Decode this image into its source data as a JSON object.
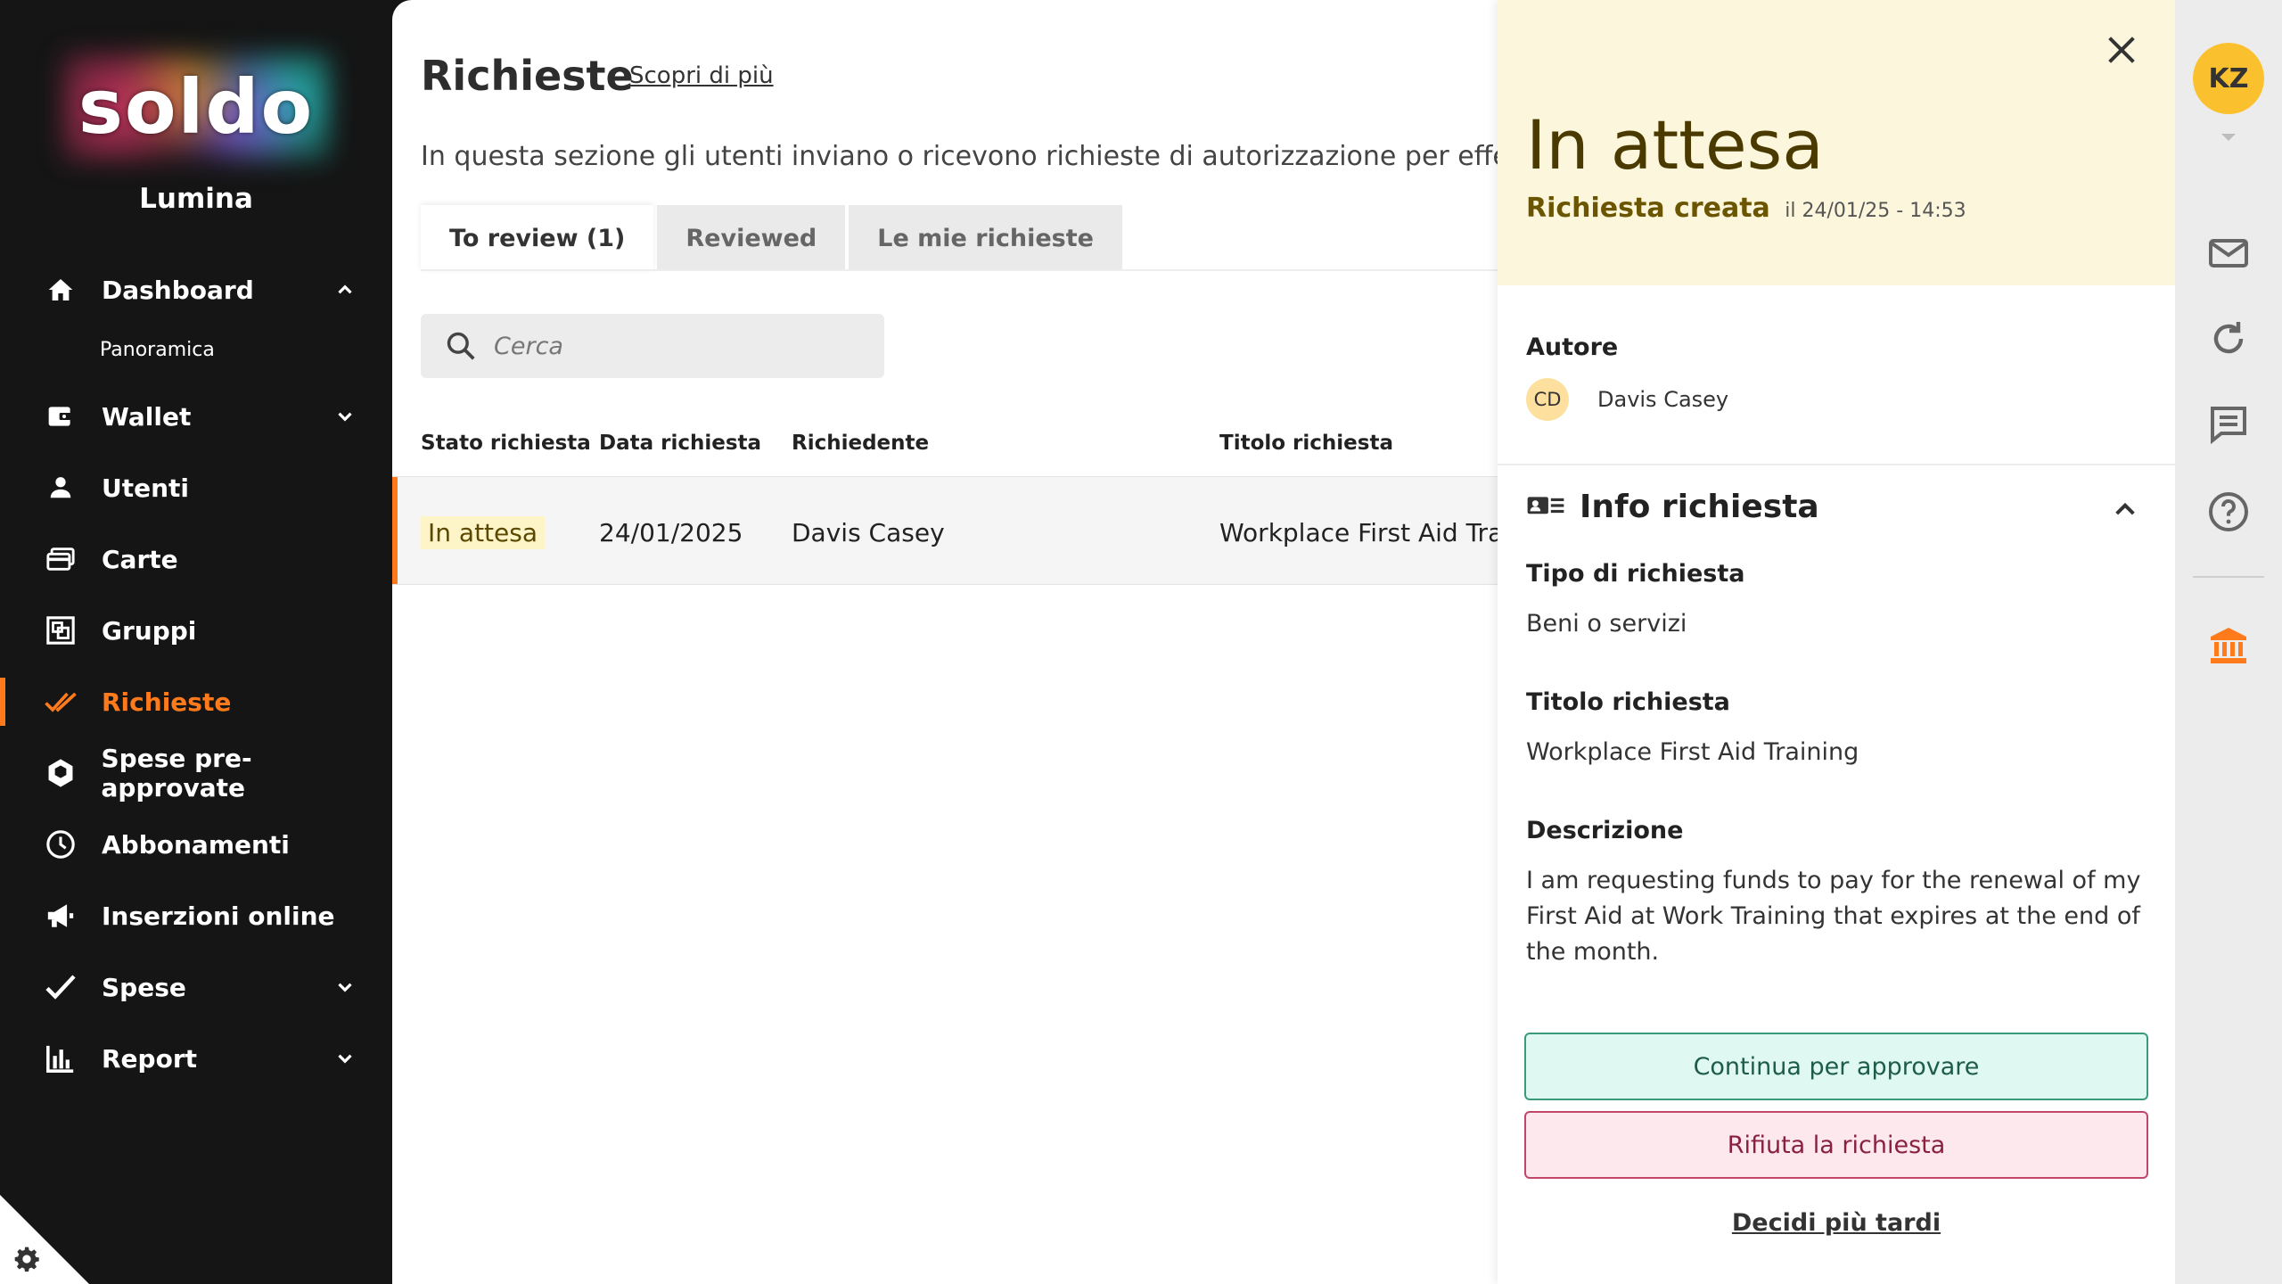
{
  "brand": {
    "logo_text": "soldo",
    "company": "Lumina",
    "accent": "#ff7a1a"
  },
  "sidebar": {
    "items": [
      {
        "label": "Dashboard",
        "icon": "home-icon",
        "chevron": "up"
      },
      {
        "label": "Panoramica",
        "sub": true
      },
      {
        "label": "Wallet",
        "icon": "wallet-icon",
        "chevron": "down"
      },
      {
        "label": "Utenti",
        "icon": "user-icon"
      },
      {
        "label": "Carte",
        "icon": "cards-icon"
      },
      {
        "label": "Gruppi",
        "icon": "groups-icon"
      },
      {
        "label": "Richieste",
        "icon": "double-check-icon",
        "active": true
      },
      {
        "label": "Spese pre-approvate",
        "icon": "hexagon-icon"
      },
      {
        "label": "Abbonamenti",
        "icon": "clock-icon"
      },
      {
        "label": "Inserzioni online",
        "icon": "megaphone-icon"
      },
      {
        "label": "Spese",
        "icon": "check-icon",
        "chevron": "down"
      },
      {
        "label": "Report",
        "icon": "bar-chart-icon",
        "chevron": "down"
      }
    ]
  },
  "main": {
    "title": "Richieste",
    "learn_more": "Scopri di più",
    "intro": "In questa sezione gli utenti inviano o ricevono richieste di autorizzazione per effettuar",
    "tabs": [
      {
        "label": "To review (1)",
        "active": true
      },
      {
        "label": "Reviewed"
      },
      {
        "label": "Le mie richieste"
      }
    ],
    "search": {
      "placeholder": "Cerca"
    },
    "table": {
      "headers": [
        "Stato richiesta",
        "Data richiesta",
        "Richiedente",
        "Titolo richiesta"
      ],
      "rows": [
        {
          "status": "In attesa",
          "date": "24/01/2025",
          "requester": "Davis Casey",
          "title": "Workplace First Aid Traini"
        }
      ]
    }
  },
  "panel": {
    "status": "In attesa",
    "created_label": "Richiesta creata",
    "created_at": "il 24/01/25 - 14:53",
    "author_label": "Autore",
    "author_initials": "CD",
    "author_name": "Davis Casey",
    "info_title": "Info richiesta",
    "type_label": "Tipo di richiesta",
    "type_value": "Beni o servizi",
    "title_label": "Titolo richiesta",
    "title_value": "Workplace First Aid Training",
    "desc_label": "Descrizione",
    "desc_value": "I am requesting funds to pay for the renewal of my First Aid at Work Training that expires at the end of the month.",
    "approve_label": "Continua per approvare",
    "reject_label": "Rifiuta la richiesta",
    "later_label": "Decidi più tardi"
  },
  "rail": {
    "user_initials": "KZ",
    "icons": [
      "mail-icon",
      "refresh-icon",
      "chat-icon",
      "help-icon",
      "bank-icon"
    ]
  }
}
